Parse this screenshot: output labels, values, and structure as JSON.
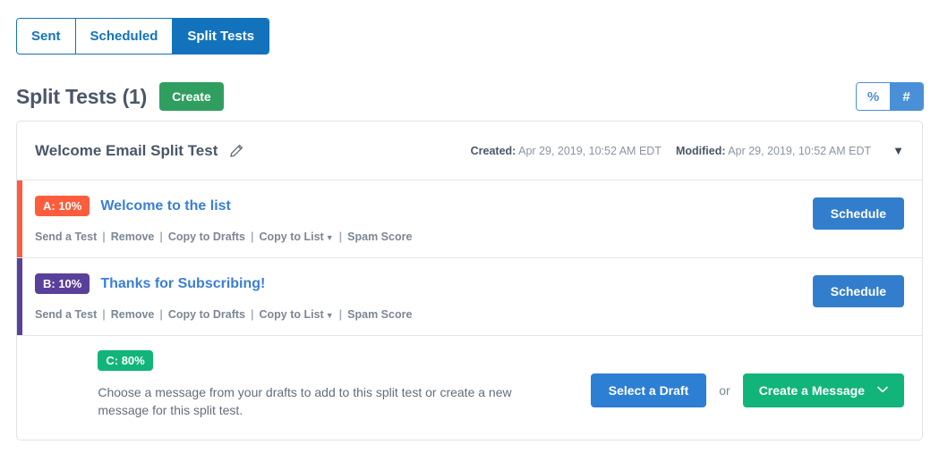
{
  "tabs": [
    {
      "label": "Sent",
      "active": false
    },
    {
      "label": "Scheduled",
      "active": false
    },
    {
      "label": "Split Tests",
      "active": true
    }
  ],
  "header": {
    "page_title": "Split Tests (1)",
    "create_label": "Create",
    "unit_percent": "%",
    "unit_number": "#"
  },
  "card": {
    "title": "Welcome Email Split Test",
    "edit_icon": "pencil-icon",
    "created_label": "Created:",
    "created_value": "Apr 29, 2019, 10:52 AM EDT",
    "modified_label": "Modified:",
    "modified_value": "Apr 29, 2019, 10:52 AM EDT",
    "collapse_icon": "▼"
  },
  "actions": {
    "send_test": "Send a Test",
    "remove": "Remove",
    "copy_to_drafts": "Copy to Drafts",
    "copy_to_list": "Copy to List",
    "spam_score": "Spam Score",
    "separator": "|",
    "caret": "▼"
  },
  "variants": [
    {
      "badge": "A: 10%",
      "name": "Welcome to the list",
      "color": "#fc5d3c",
      "button_label": "Schedule"
    },
    {
      "badge": "B: 10%",
      "name": "Thanks for Subscribing!",
      "color": "#59409b",
      "button_label": "Schedule"
    }
  ],
  "empty_variant": {
    "badge": "C: 80%",
    "color": "#12b579",
    "text": "Choose a message from your drafts to add to this split test or create a new message for this split test.",
    "select_draft_label": "Select a Draft",
    "or_label": "or",
    "create_message_label": "Create a Message",
    "create_message_caret": "⌄"
  }
}
